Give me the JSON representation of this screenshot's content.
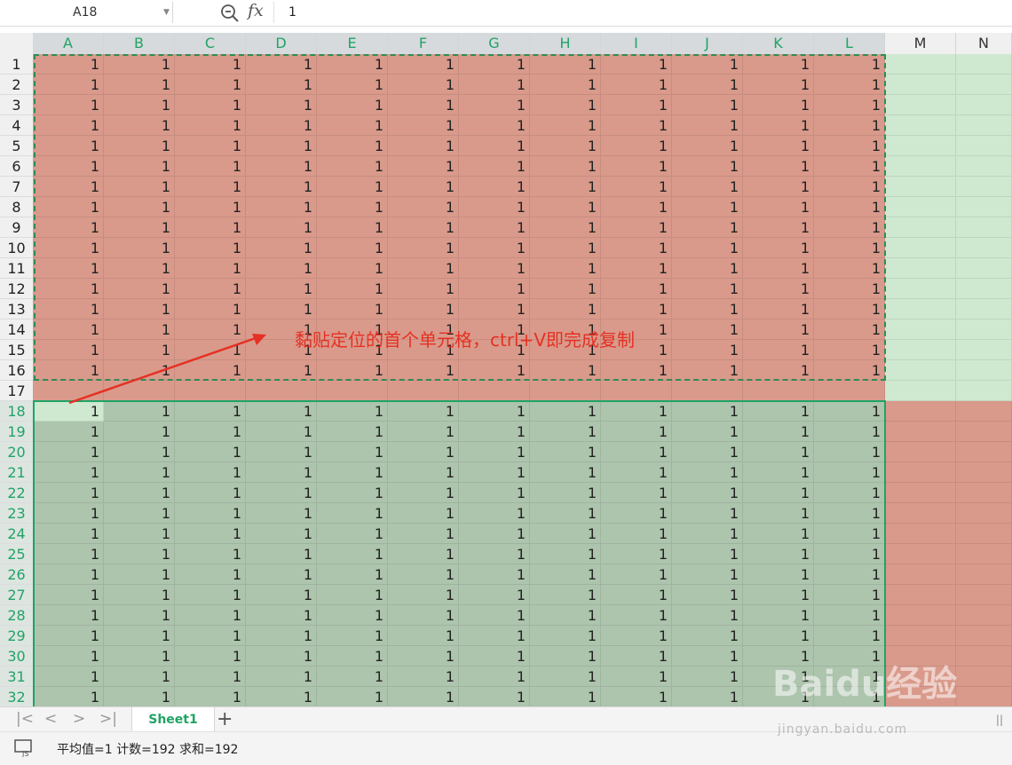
{
  "formula_bar": {
    "name_box": "A18",
    "formula_value": "1"
  },
  "columns": [
    "A",
    "B",
    "C",
    "D",
    "E",
    "F",
    "G",
    "H",
    "I",
    "J",
    "K",
    "L",
    "M",
    "N"
  ],
  "rows": [
    "1",
    "2",
    "3",
    "4",
    "5",
    "6",
    "7",
    "8",
    "9",
    "10",
    "11",
    "12",
    "13",
    "14",
    "15",
    "16",
    "17",
    "18",
    "19",
    "20",
    "21",
    "22",
    "23",
    "24",
    "25",
    "26",
    "27",
    "28",
    "29",
    "30",
    "31",
    "32"
  ],
  "cell_value": "1",
  "annotation": "黏贴定位的首个单元格，ctrl+V即完成复制",
  "sheet_tabs": {
    "active": "Sheet1"
  },
  "status_bar": {
    "text": "平均值=1  计数=192  求和=192"
  },
  "watermark": {
    "main": "Baidu经验",
    "sub": "jingyan.baidu.com"
  },
  "colors": {
    "copied_fill": "#d99a8b",
    "pasted_fill": "#adc4ad",
    "light_green": "#cfe8d0",
    "accent_green": "#21a366",
    "annotation_red": "#e53124"
  }
}
